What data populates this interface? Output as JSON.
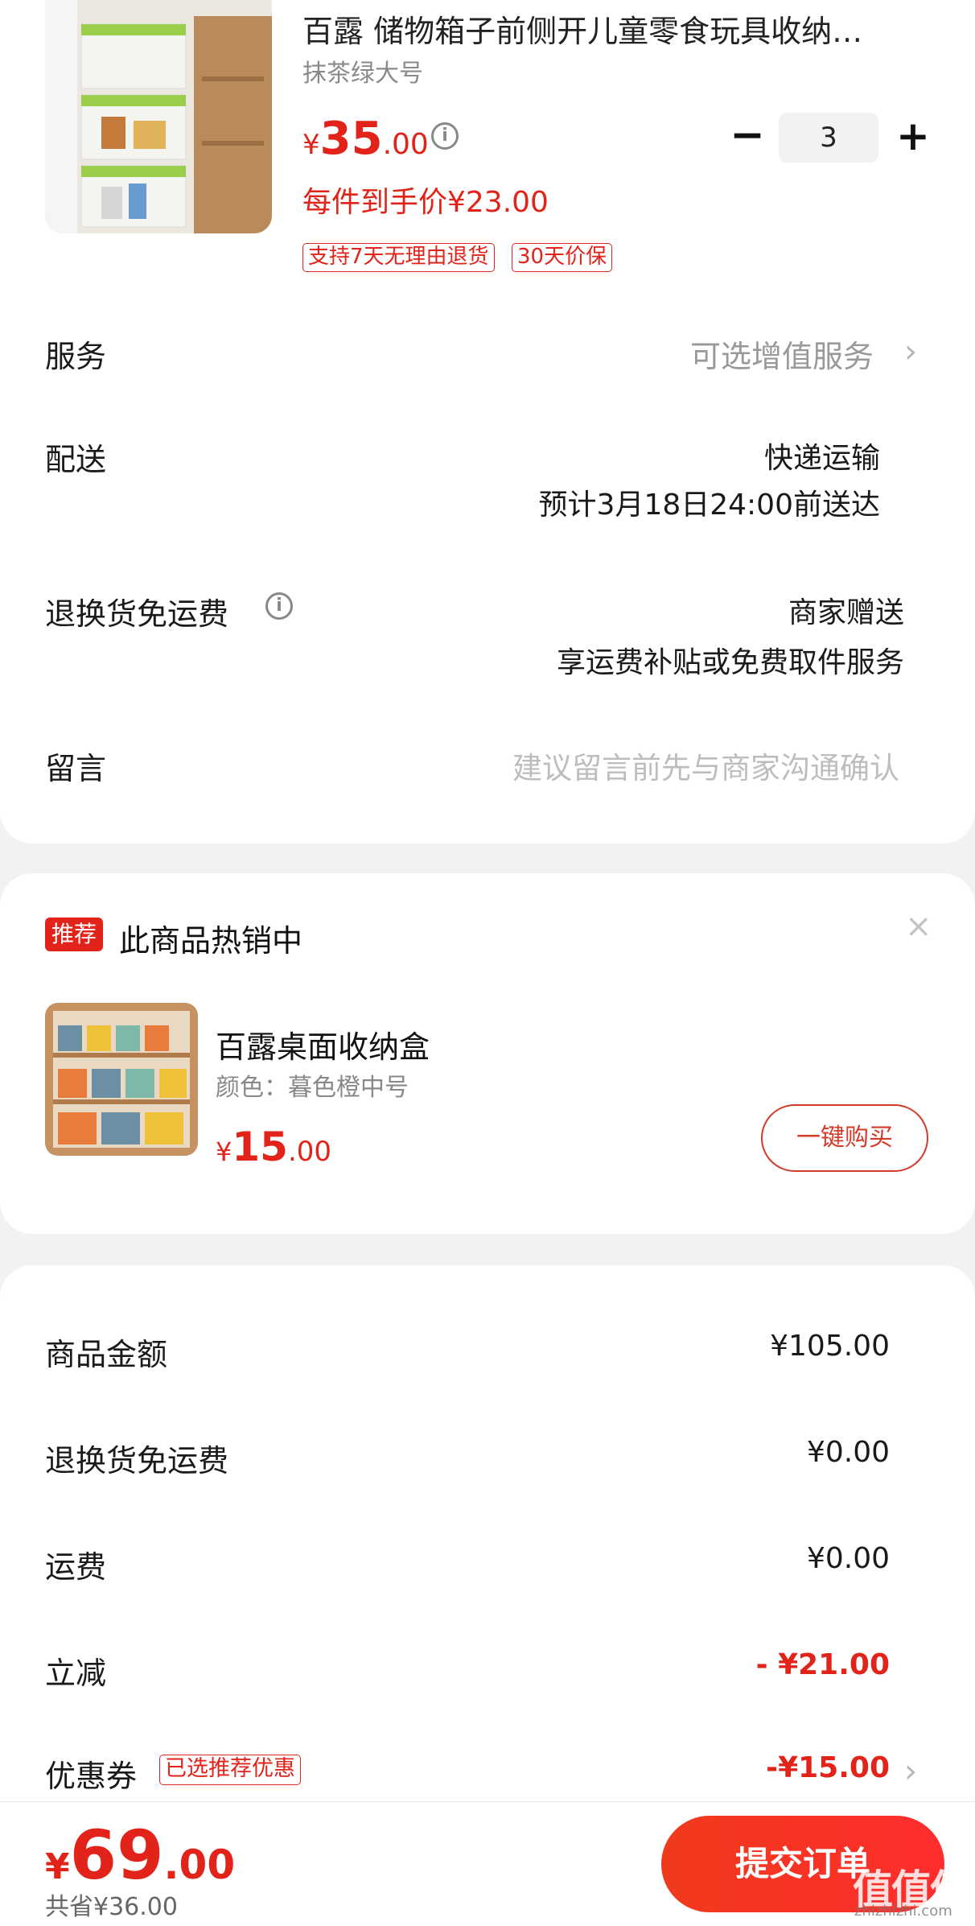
{
  "product": {
    "title": "百露 储物箱子前侧开儿童零食玩具收纳…",
    "variant": "抹茶绿大号",
    "price_symbol": "¥",
    "price_int": "35",
    "price_dec": ".00",
    "quantity": "3",
    "qty_minus": "−",
    "qty_plus": "+",
    "per_item_price": "每件到手价¥23.00",
    "tags": [
      "支持7天无理由退货",
      "30天价保"
    ]
  },
  "rows": {
    "service_label": "服务",
    "service_value": "可选增值服务",
    "delivery_label": "配送",
    "delivery_method": "快递运输",
    "delivery_eta": "预计3月18日24:00前送达",
    "return_label": "退换货免运费",
    "return_value1": "商家赠送",
    "return_value2": "享运费补贴或免费取件服务",
    "message_label": "留言",
    "message_placeholder": "建议留言前先与商家沟通确认"
  },
  "recommend": {
    "badge": "推荐",
    "title": "此商品热销中",
    "close": "×",
    "name": "百露桌面收纳盒",
    "color": "颜色：暮色橙中号",
    "price_symbol": "¥",
    "price_int": "15",
    "price_dec": ".00",
    "buy_label": "一键购买"
  },
  "summary": {
    "goods_label": "商品金额",
    "goods_value": "¥105.00",
    "return_label": "退换货免运费",
    "return_value": "¥0.00",
    "shipping_label": "运费",
    "shipping_value": "¥0.00",
    "discount_label": "立减",
    "discount_value": "- ¥21.00",
    "coupon_label": "优惠券",
    "coupon_tag": "已选推荐优惠",
    "coupon_value": "-¥15.00"
  },
  "footer": {
    "total_symbol": "¥",
    "total_int": "69",
    "total_dec": ".00",
    "saved": "共省¥36.00",
    "submit_label": "提交订单",
    "watermark": "值值值",
    "watermark_sub": "zhizhizhi.com"
  },
  "colors": {
    "accent": "#e2231a",
    "muted": "#999999",
    "background": "#f2f2f2"
  }
}
